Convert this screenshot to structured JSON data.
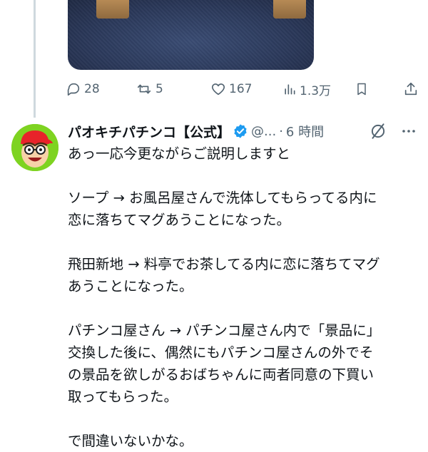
{
  "media": {
    "mute_icon": "speaker-muted-icon"
  },
  "actions": {
    "reply_count": "28",
    "retweet_count": "5",
    "like_count": "167",
    "views_count": "1.3万"
  },
  "author": {
    "name": "パオキチパチンコ【公式】",
    "handle": "@...",
    "separator": "·",
    "time": "6 時間"
  },
  "tweet": {
    "lines": [
      "あっ一応今更ながらご説明しますと",
      "",
      "ソープ → お風呂屋さんで洗体してもらってる内に",
      "恋に落ちてマグあうことになった。",
      "",
      "飛田新地 → 料亭でお茶してる内に恋に落ちてマグ",
      "あうことになった。",
      "",
      "パチンコ屋さん → パチンコ屋さん内で「景品に」",
      "交換した後に、偶然にもパチンコ屋さんの外でそ",
      "の景品を欲しがるおばちゃんに両者同意の下買い",
      "取ってもらった。",
      "",
      "で間違いないかな。"
    ]
  },
  "colors": {
    "accent": "#1d9bf0",
    "muted": "#536471",
    "avatar_bg": "#7ed321"
  }
}
